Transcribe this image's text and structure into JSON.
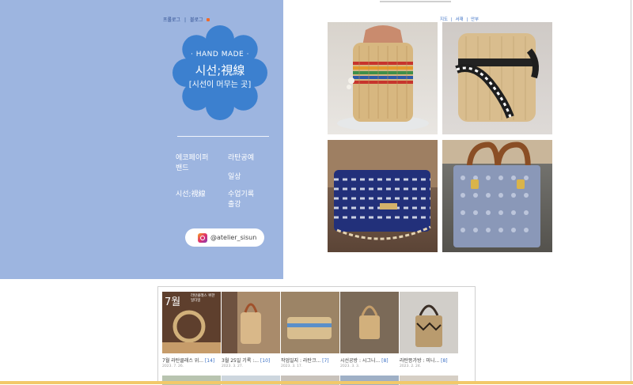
{
  "blog": {
    "links": [
      "프롤로그",
      "블로그"
    ]
  },
  "profile": {
    "hand_made": "· HAND MADE ·",
    "title": "시선;視線",
    "subtitle": "[시선이 머무는 곳]",
    "menu": {
      "item1": "에코페이퍼\n밴드",
      "item2": "라탄공예",
      "item3": "일상",
      "item4": "시선;視線",
      "item5": "수업기록\n출강"
    },
    "instagram": "@atelier_sisun"
  },
  "top_links": [
    "지도",
    "서재",
    "안부"
  ],
  "widget": {
    "posts": [
      {
        "title": "7월 라탄클래스 위...",
        "count": "[14]",
        "date": "2023. 7. 26."
      },
      {
        "title": "3월 25일 기록 :...",
        "count": "[10]",
        "date": "2023. 3. 27."
      },
      {
        "title": "작업일지 : 라탄크...",
        "count": "[7]",
        "date": "2023. 3. 17."
      },
      {
        "title": "시선공방 : 시그니...",
        "count": "[8]",
        "date": "2023. 3. 3."
      },
      {
        "title": "라탄뜽가방 : 미니...",
        "count": "[8]",
        "date": "2023. 2. 24."
      }
    ],
    "thumb_label": "7월",
    "thumb_sub": "라탄클래스 위한\n일타일"
  },
  "colors": {
    "panel": "#9db5e0",
    "flower": "#3c80cf",
    "accent": "#3a6fc4"
  }
}
